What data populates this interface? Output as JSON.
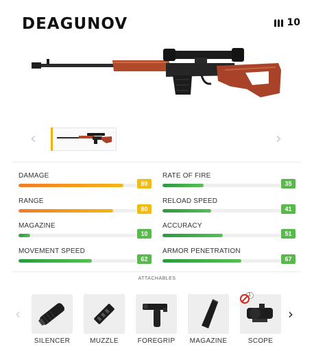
{
  "weapon": {
    "name": "DEAGUNOV",
    "ammo": "10"
  },
  "stats": [
    {
      "label": "DAMAGE",
      "value": "89",
      "level": 0.89,
      "color": "orange"
    },
    {
      "label": "RATE OF FIRE",
      "value": "35",
      "level": 0.35,
      "color": "green"
    },
    {
      "label": "RANGE",
      "value": "80",
      "level": 0.8,
      "color": "orange"
    },
    {
      "label": "RELOAD SPEED",
      "value": "41",
      "level": 0.41,
      "color": "green"
    },
    {
      "label": "MAGAZINE",
      "value": "10",
      "level": 0.1,
      "color": "green"
    },
    {
      "label": "ACCURACY",
      "value": "51",
      "level": 0.51,
      "color": "green"
    },
    {
      "label": "MOVEMENT SPEED",
      "value": "62",
      "level": 0.62,
      "color": "green"
    },
    {
      "label": "ARMOR PENETRATION",
      "value": "67",
      "level": 0.67,
      "color": "green"
    }
  ],
  "attachables": {
    "title": "ATTACHABLES",
    "items": [
      {
        "name": "SILENCER",
        "icon": "silencer-icon"
      },
      {
        "name": "MUZZLE",
        "icon": "muzzle-icon"
      },
      {
        "name": "FOREGRIP",
        "icon": "foregrip-icon"
      },
      {
        "name": "MAGAZINE",
        "icon": "magazine-icon"
      },
      {
        "name": "SCOPE",
        "icon": "scope-icon",
        "badge": "1",
        "unavailable": true
      }
    ]
  },
  "colors": {
    "orange": "#f2bb16",
    "green": "#5ab84e",
    "accent": "#f2b10c"
  }
}
